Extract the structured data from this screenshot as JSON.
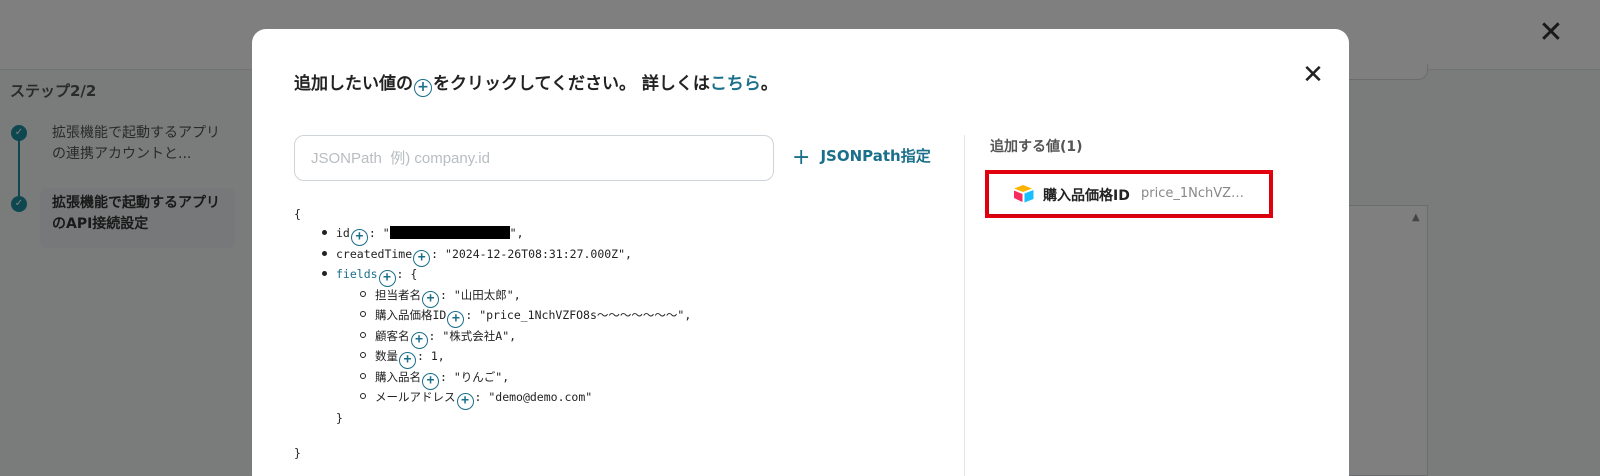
{
  "background": {
    "title": "",
    "step_heading": "ステップ2/2",
    "steps": [
      {
        "label": "拡張機能で起動するアプリの連携アカウントと..."
      },
      {
        "label": "拡張機能で起動するアプリのAPI接続設定"
      }
    ],
    "close_glyph": "✕"
  },
  "modal": {
    "title_prefix": "追加したい値の",
    "title_suffix": "をクリックしてください。 詳しくは",
    "title_link": "こちら",
    "title_end": "。",
    "close_glyph": "✕",
    "search": {
      "placeholder": "JSONPath  例) company.id",
      "value": ""
    },
    "jsonpath_button": "JSONPath指定",
    "added_heading": "追加する値(1)",
    "added_items": [
      {
        "name": "購入品価格ID",
        "value": "price_1NchVZ…",
        "icon": "airtable-icon"
      }
    ]
  },
  "json_tree": {
    "open_brace": "{",
    "close_brace": "}",
    "id_key": "id",
    "createdTime_key": "createdTime",
    "createdTime_value": ": \"2024-12-26T08:31:27.000Z\",",
    "fields_key": "fields",
    "fields_open": ": {",
    "fields_close": "}",
    "fields": [
      {
        "key": "担当者名",
        "value": ": \"山田太郎\","
      },
      {
        "key": "購入品価格ID",
        "value": ": \"price_1NchVZFO8s～～～～～～～\","
      },
      {
        "key": "顧客名",
        "value": ": \"株式会社A\","
      },
      {
        "key": "数量",
        "value": ": 1,"
      },
      {
        "key": "購入品名",
        "value": ": \"りんご\","
      },
      {
        "key": "メールアドレス",
        "value": ": \"demo@demo.com\""
      }
    ]
  },
  "colors": {
    "accent": "#1a6f8a",
    "highlight": "#e3000f"
  }
}
